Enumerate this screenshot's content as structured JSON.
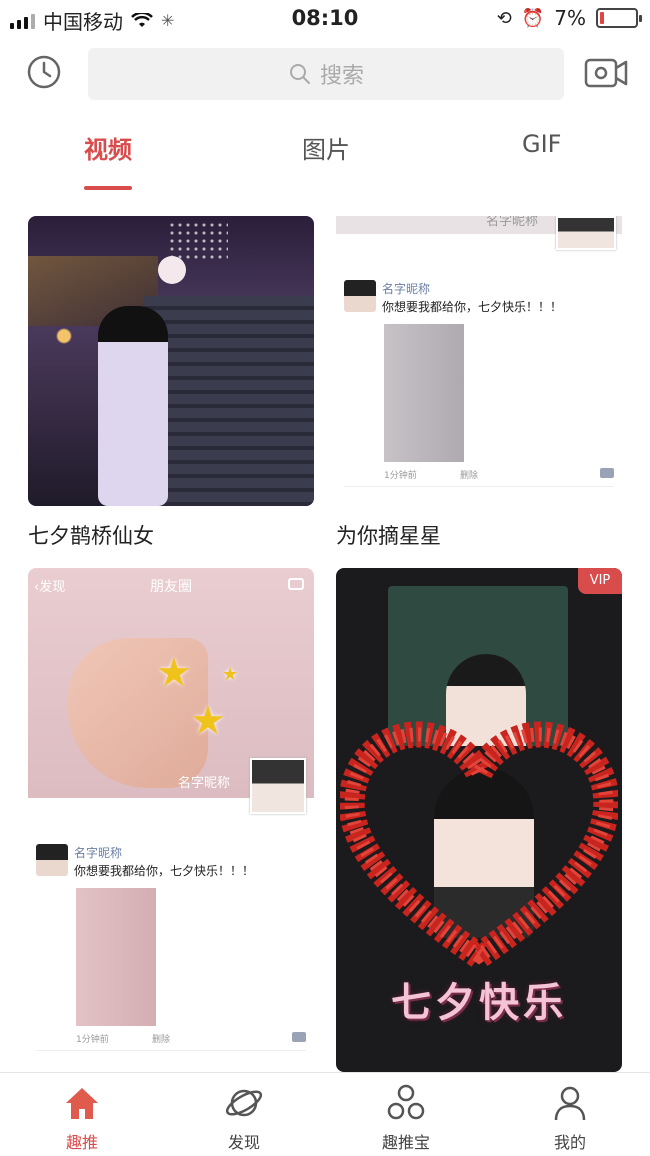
{
  "status_bar": {
    "carrier": "中国移动",
    "time": "08:10",
    "battery": "7%"
  },
  "header": {
    "search_placeholder": "搜索",
    "icons": [
      "clock-icon",
      "camera-icon",
      "search-icon"
    ]
  },
  "tabs": [
    {
      "label": "视频",
      "active": true
    },
    {
      "label": "图片",
      "active": false
    },
    {
      "label": "GIF",
      "active": false
    }
  ],
  "cards": {
    "card1": {
      "caption": "七夕鹊桥仙女"
    },
    "card2": {
      "caption": "为你摘星星",
      "strip_name": "名字昵称",
      "post_name": "名字昵称",
      "post_message": "你想要我都给你，七夕快乐！！！",
      "post_time": "1分钟前",
      "post_delete": "删除"
    },
    "card3": {
      "back_label": "发现",
      "title": "朋友圈",
      "overlay_name": "名字昵称",
      "post_name": "名字昵称",
      "post_message": "你想要我都给你，七夕快乐！！！",
      "post_time": "1分钟前",
      "post_delete": "删除"
    },
    "card4": {
      "badge": "VIP",
      "overlay_text": "七夕快乐"
    }
  },
  "nav": [
    {
      "label": "趣推",
      "icon": "home-icon",
      "active": true
    },
    {
      "label": "发现",
      "icon": "planet-icon",
      "active": false
    },
    {
      "label": "趣推宝",
      "icon": "circles-icon",
      "active": false
    },
    {
      "label": "我的",
      "icon": "user-icon",
      "active": false
    }
  ],
  "colors": {
    "accent": "#d94c4c"
  }
}
